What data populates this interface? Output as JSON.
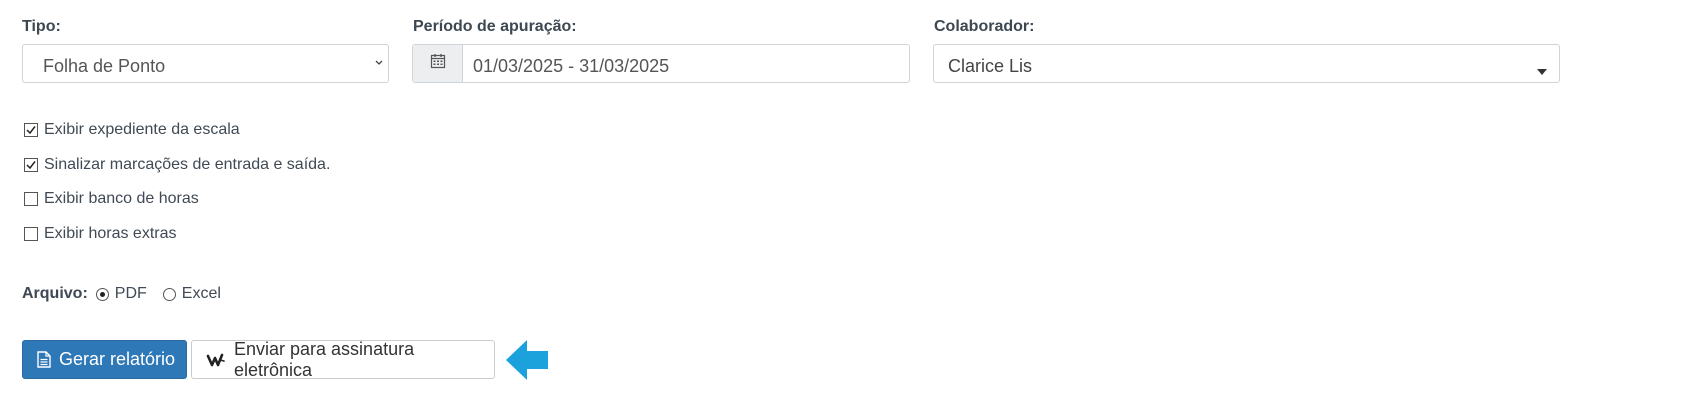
{
  "form": {
    "tipo": {
      "label": "Tipo:",
      "value": "Folha de Ponto"
    },
    "periodo": {
      "label": "Período de apuração:",
      "value": "01/03/2025 - 31/03/2025"
    },
    "colaborador": {
      "label": "Colaborador:",
      "value": "Clarice Lis"
    }
  },
  "options": [
    {
      "label": "Exibir expediente da escala",
      "checked": true
    },
    {
      "label": "Sinalizar marcações de entrada e saída.",
      "checked": true
    },
    {
      "label": "Exibir banco de horas",
      "checked": false
    },
    {
      "label": "Exibir horas extras",
      "checked": false
    }
  ],
  "arquivo": {
    "label": "Arquivo:",
    "choices": [
      {
        "label": "PDF",
        "selected": true
      },
      {
        "label": "Excel",
        "selected": false
      }
    ]
  },
  "actions": {
    "generate_label": "Gerar relatório",
    "sign_label": "Enviar para assinatura eletrônica"
  },
  "colors": {
    "primary_button": "#2f78b7",
    "arrow": "#1ba1dc"
  },
  "icons": {
    "calendar": "calendar-icon",
    "document": "document-icon",
    "signature": "signature-icon",
    "arrow": "arrow-left-icon"
  }
}
